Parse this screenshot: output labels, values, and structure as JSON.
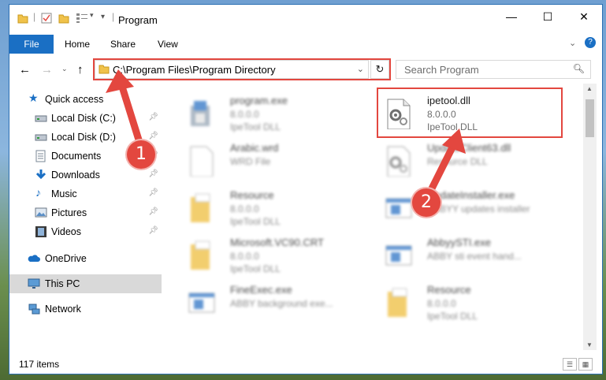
{
  "window": {
    "title": "Program",
    "controls": {
      "minimize": "—",
      "maximize": "☐",
      "close": "✕"
    }
  },
  "ribbon": {
    "tabs": [
      "File",
      "Home",
      "Share",
      "View"
    ],
    "help_glyph": "?"
  },
  "address": {
    "path": "C:\\Program Files\\Program Directory",
    "search_placeholder": "Search Program"
  },
  "nav_pane": {
    "items": [
      {
        "label": "Quick access",
        "icon": "star-icon"
      },
      {
        "label": "Local Disk (C:)",
        "icon": "drive-icon",
        "pinned": true
      },
      {
        "label": "Local Disk (D:)",
        "icon": "drive-icon",
        "pinned": true
      },
      {
        "label": "Documents",
        "icon": "documents-icon",
        "pinned": true
      },
      {
        "label": "Downloads",
        "icon": "download-icon",
        "pinned": true
      },
      {
        "label": "Music",
        "icon": "music-icon",
        "pinned": true
      },
      {
        "label": "Pictures",
        "icon": "pictures-icon",
        "pinned": true
      },
      {
        "label": "Videos",
        "icon": "videos-icon",
        "pinned": true
      },
      {
        "label": "OneDrive",
        "icon": "cloud-icon"
      },
      {
        "label": "This PC",
        "icon": "monitor-icon",
        "selected": true
      },
      {
        "label": "Network",
        "icon": "network-icon"
      }
    ],
    "pin_glyph": "📌"
  },
  "files": [
    {
      "name": "program.exe",
      "line1": "8.0.0.0",
      "line2": "IpeTool DLL",
      "icon": "installer-icon"
    },
    {
      "name": "ipetool.dll",
      "line1": "8.0.0.0",
      "line2": "IpeTool DLL",
      "icon": "dll-gear-icon",
      "highlighted": true
    },
    {
      "name": "Arabic.wrd",
      "line1": "WRD File",
      "line2": "",
      "icon": "blank-file-icon"
    },
    {
      "name": "UpdateClient63.dll",
      "line1": "Resource DLL",
      "line2": "",
      "icon": "dll-gear-icon"
    },
    {
      "name": "Resource",
      "line1": "8.0.0.0",
      "line2": "IpeTool DLL",
      "icon": "folder-file-icon"
    },
    {
      "name": "UpdateInstaller.exe",
      "line1": "ABBYY updates installer",
      "line2": "",
      "icon": "app-window-icon"
    },
    {
      "name": "Microsoft.VC90.CRT",
      "line1": "8.0.0.0",
      "line2": "IpeTool DLL",
      "icon": "folder-file-icon"
    },
    {
      "name": "AbbyySTI.exe",
      "line1": "ABBY sti event hand...",
      "line2": "",
      "icon": "app-window-icon"
    },
    {
      "name": "FineExec.exe",
      "line1": "ABBY background exe...",
      "line2": "",
      "icon": "app-window-icon"
    },
    {
      "name": "Resource",
      "line1": "8.0.0.0",
      "line2": "IpeTool DLL",
      "icon": "folder-file-icon"
    }
  ],
  "status": {
    "items_count": "117 items"
  },
  "callouts": [
    {
      "number": "1"
    },
    {
      "number": "2"
    }
  ],
  "colors": {
    "accent": "#1a6fc4",
    "callout_red": "#e3473f",
    "selection": "#d9d9d9"
  }
}
